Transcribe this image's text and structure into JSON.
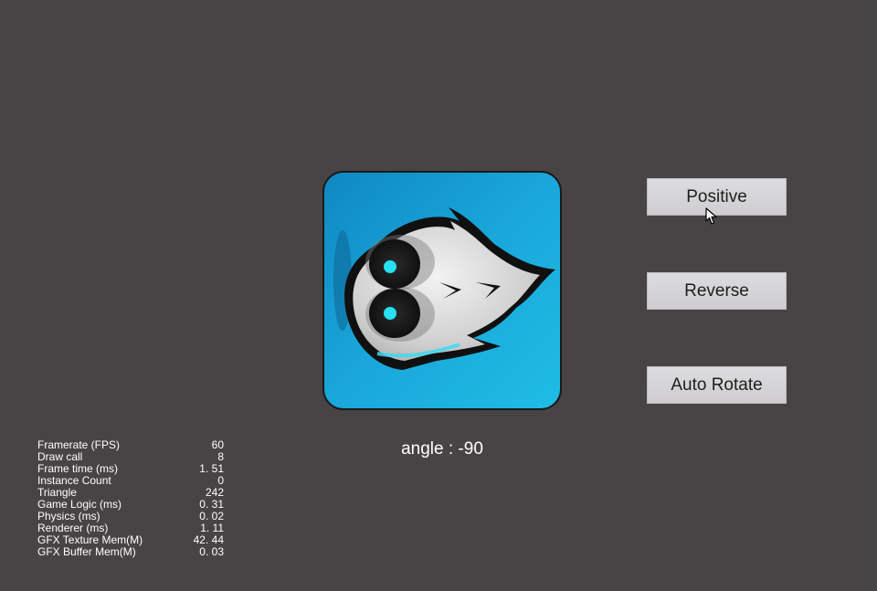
{
  "buttons": {
    "positive": "Positive",
    "reverse": "Reverse",
    "auto_rotate": "Auto Rotate"
  },
  "angle_label": "angle : -90",
  "sprite": {
    "icon": "cocos-creator-logo-icon",
    "colors": {
      "background": "#1fa8d8",
      "outline": "#111111",
      "eyes": "#27e0f2"
    }
  },
  "stats": [
    {
      "label": "Framerate (FPS)",
      "value": "60"
    },
    {
      "label": "Draw call",
      "value": "8"
    },
    {
      "label": "Frame time (ms)",
      "value": "1. 51"
    },
    {
      "label": "Instance Count",
      "value": "0"
    },
    {
      "label": "Triangle",
      "value": "242"
    },
    {
      "label": "Game Logic (ms)",
      "value": "0. 31"
    },
    {
      "label": "Physics (ms)",
      "value": "0. 02"
    },
    {
      "label": "Renderer (ms)",
      "value": "1. 11"
    },
    {
      "label": "GFX Texture Mem(M)",
      "value": "42. 44"
    },
    {
      "label": "GFX Buffer Mem(M)",
      "value": "0. 03"
    }
  ]
}
